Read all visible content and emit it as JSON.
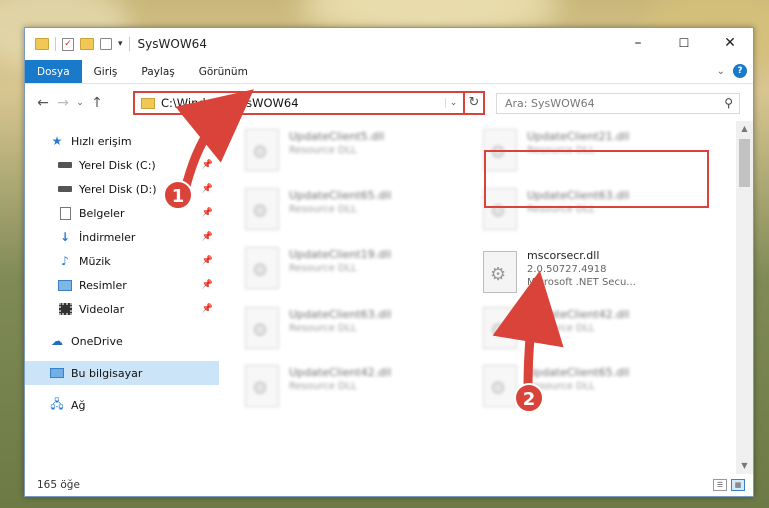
{
  "window": {
    "title": "SysWOW64",
    "controls": {
      "minimize": "–",
      "maximize": "☐",
      "close": "✕"
    }
  },
  "ribbon": {
    "tabs": [
      "Dosya",
      "Giriş",
      "Paylaş",
      "Görünüm"
    ],
    "active_tab": "Dosya",
    "help": "?"
  },
  "navigation": {
    "address": "C:\\Windows\\SysWOW64",
    "search_placeholder": "Ara: SysWOW64"
  },
  "sidebar": {
    "items": [
      {
        "label": "Hızlı erişim",
        "icon": "star-icon",
        "pinned": false
      },
      {
        "label": "Yerel Disk (C:)",
        "icon": "drive-icon",
        "pinned": true
      },
      {
        "label": "Yerel Disk (D:)",
        "icon": "drive-icon",
        "pinned": true
      },
      {
        "label": "Belgeler",
        "icon": "documents-icon",
        "pinned": true
      },
      {
        "label": "İndirmeler",
        "icon": "download-icon",
        "pinned": true
      },
      {
        "label": "Müzik",
        "icon": "music-icon",
        "pinned": true
      },
      {
        "label": "Resimler",
        "icon": "pictures-icon",
        "pinned": true
      },
      {
        "label": "Videolar",
        "icon": "video-icon",
        "pinned": true
      },
      {
        "label": "OneDrive",
        "icon": "cloud-icon",
        "pinned": false
      },
      {
        "label": "Bu bilgisayar",
        "icon": "computer-icon",
        "pinned": false,
        "selected": true
      },
      {
        "label": "Ağ",
        "icon": "network-icon",
        "pinned": false
      }
    ]
  },
  "files": [
    {
      "name": "UpdateClient5.dll",
      "sub": "Resource DLL"
    },
    {
      "name": "UpdateClient21.dll",
      "sub": "Resource DLL"
    },
    {
      "name": "UpdateClient65.dll",
      "sub": "Resource DLL"
    },
    {
      "name": "UpdateClient63.dll",
      "sub": "Resource DLL"
    },
    {
      "name": "UpdateClient19.dll",
      "sub": "Resource DLL"
    },
    {
      "name": "mscorsecr.dll",
      "sub": "2.0.50727.4918",
      "sub2": "Microsoft .NET Secu...",
      "highlighted": true
    },
    {
      "name": "UpdateClient63.dll",
      "sub": "Resource DLL"
    },
    {
      "name": "UpdateClient42.dll",
      "sub": "Resource DLL"
    },
    {
      "name": "UpdateClient42.dll",
      "sub": "Resource DLL"
    },
    {
      "name": "UpdateClient65.dll",
      "sub": "Resource DLL"
    }
  ],
  "status": {
    "count": "165 öğe"
  },
  "callouts": {
    "one": "1",
    "two": "2"
  },
  "colors": {
    "accent": "#1979ca",
    "callout": "#d9433a"
  }
}
